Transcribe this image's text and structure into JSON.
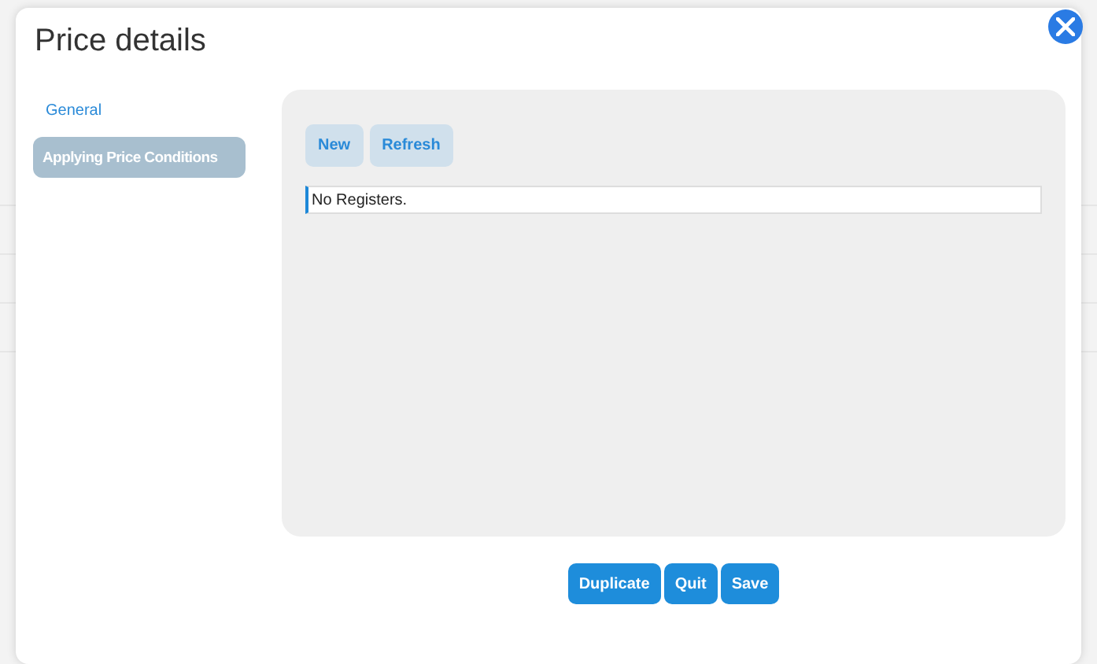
{
  "dialog": {
    "title": "Price details"
  },
  "sidebar": {
    "items": [
      {
        "label": "General",
        "selected": false
      },
      {
        "label": "Applying Price Conditions",
        "selected": true
      }
    ]
  },
  "toolbar": {
    "buttons": [
      "New",
      "Refresh"
    ]
  },
  "table": {
    "empty_message": "No Registers."
  },
  "footer": {
    "buttons": [
      "Duplicate",
      "Quit",
      "Save"
    ]
  }
}
